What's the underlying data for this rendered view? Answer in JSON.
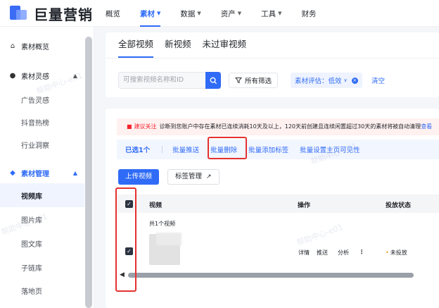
{
  "app": {
    "logo_text": "巨量营销"
  },
  "top_nav": [
    {
      "label": "概览",
      "dropdown": false,
      "active": false
    },
    {
      "label": "素材",
      "dropdown": true,
      "active": true
    },
    {
      "label": "数据",
      "dropdown": true,
      "active": false
    },
    {
      "label": "资产",
      "dropdown": true,
      "active": false
    },
    {
      "label": "工具",
      "dropdown": true,
      "active": false
    },
    {
      "label": "财务",
      "dropdown": false,
      "active": false
    }
  ],
  "sidebar": {
    "items": [
      {
        "label": "素材概览",
        "icon": "home-icon",
        "type": "group"
      },
      {
        "label": "素材灵感",
        "icon": "bulb-icon",
        "type": "group",
        "expanded": true
      },
      {
        "label": "广告灵感",
        "type": "sub"
      },
      {
        "label": "抖音热榜",
        "type": "sub"
      },
      {
        "label": "行业洞察",
        "type": "sub"
      },
      {
        "label": "素材管理",
        "icon": "layers-icon",
        "type": "group",
        "expanded": true,
        "active": true
      },
      {
        "label": "视频库",
        "type": "sub",
        "selected": true
      },
      {
        "label": "图片库",
        "type": "sub"
      },
      {
        "label": "图文库",
        "type": "sub"
      },
      {
        "label": "子链库",
        "type": "sub"
      },
      {
        "label": "落地页",
        "type": "sub"
      }
    ]
  },
  "tabs": [
    "全部视频",
    "新视频",
    "未过审视频"
  ],
  "filters": {
    "search_placeholder": "可搜索视频名称和ID",
    "all_filters_label": "所有筛选",
    "active_tag": "素材评估：低效",
    "clear_label": "清空"
  },
  "notice": {
    "title": "建议关注",
    "text": "诊断到您账户中存在素材已连续消耗10天及以上，120天前创建且连续闲置超过30天的素材将被自动清理",
    "link": "查看"
  },
  "bulk": {
    "selected_label": "已选1个",
    "actions": [
      "批量推送",
      "批量删除",
      "批量添加标签",
      "批量设置主页可见性"
    ]
  },
  "toolbar": {
    "upload_label": "上传视频",
    "tag_manage_label": "标签管理"
  },
  "table": {
    "headers": [
      "视频",
      "操作",
      "投放状态"
    ],
    "summary": "共1个视频",
    "row": {
      "ops": [
        "详情",
        "推送",
        "分析",
        "⋮"
      ],
      "status": "未投放"
    }
  },
  "watermark": "帮助中心-e01",
  "colors": {
    "accent": "#2f6bf6",
    "highlight": "#e5312f"
  }
}
